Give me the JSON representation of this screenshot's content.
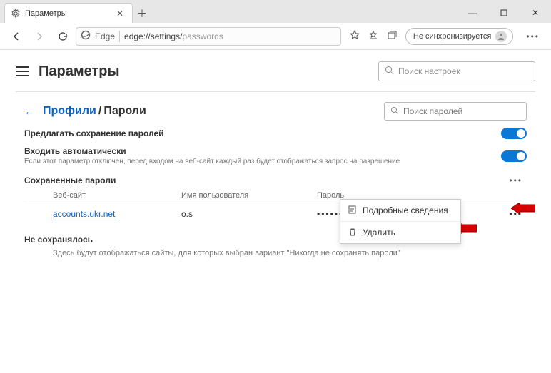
{
  "window": {
    "tab_title": "Параметры",
    "url_scheme_label": "Edge",
    "url_base": "edge://settings/",
    "url_path": "passwords",
    "sync_label": "Не синхронизируется"
  },
  "heading": {
    "title": "Параметры",
    "search_placeholder": "Поиск настроек"
  },
  "breadcrumb": {
    "profiles": "Профили",
    "current": "Пароли",
    "search_placeholder": "Поиск паролей"
  },
  "options": {
    "offer_save": {
      "label": "Предлагать сохранение паролей"
    },
    "auto_signin": {
      "label": "Входить автоматически",
      "sub": "Если этот параметр отключен, перед входом на веб-сайт каждый раз будет отображаться запрос на разрешение"
    }
  },
  "saved": {
    "heading": "Сохраненные пароли",
    "columns": {
      "site": "Веб-сайт",
      "user": "Имя пользователя",
      "pass": "Пароль"
    },
    "rows": [
      {
        "site": "accounts.ukr.net",
        "user": "o.s",
        "pass": "••••••••"
      }
    ]
  },
  "ctx": {
    "details": "Подробные сведения",
    "delete": "Удалить"
  },
  "never": {
    "heading": "Не сохранялось",
    "sub": "Здесь будут отображаться сайты, для которых выбран вариант \"Никогда не сохранять пароли\""
  }
}
